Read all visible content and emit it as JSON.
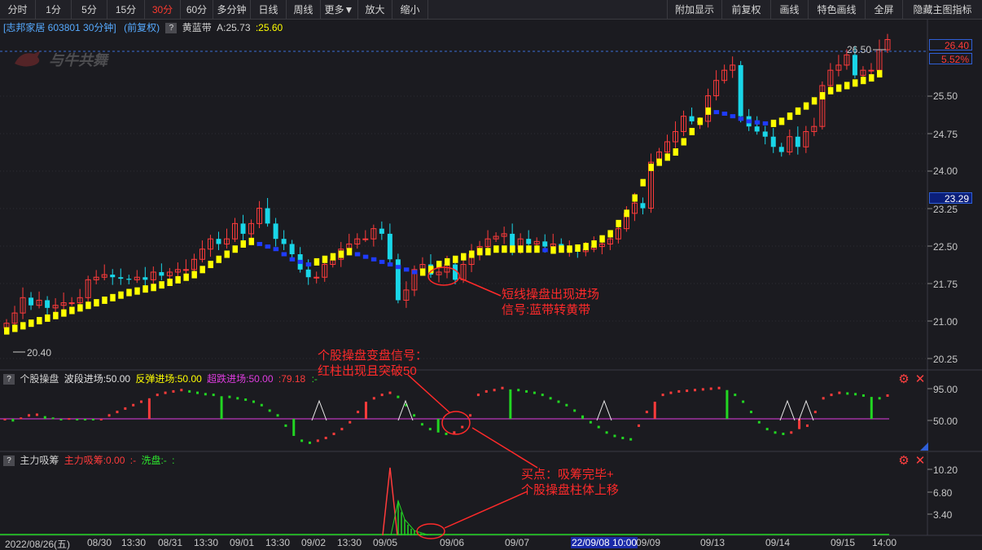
{
  "toolbar": {
    "periods": [
      "分时",
      "1分",
      "5分",
      "15分",
      "30分",
      "60分",
      "多分钟",
      "日线",
      "周线",
      "更多▼",
      "放大",
      "缩小"
    ],
    "active_period": "30分",
    "right_buttons": [
      "附加显示",
      "前复权",
      "画线",
      "特色画线",
      "全屏",
      "隐藏主图指标"
    ]
  },
  "main": {
    "stock_label": "[志邦家居 603801 30分钟]",
    "adjust_label": "(前复权)",
    "qmark": "?",
    "indicator_name": "黄蓝带",
    "indicator_a": "A:25.73",
    "indicator_b": ":25.60",
    "watermark": "与牛共舞",
    "price_tag": "26.40",
    "pct_tag": "5.52%",
    "cursor_price": "23.29",
    "high_mark": "26.50",
    "low_mark": "20.40",
    "y_ticks": [
      "25.50",
      "24.75",
      "24.00",
      "23.25",
      "22.50",
      "21.75",
      "21.00",
      "20.25"
    ]
  },
  "panel1": {
    "qmark": "?",
    "name": "个股操盘",
    "wave": "波段进场:50.00",
    "rebound": "反弹进场:50.00",
    "oversold": "超跌进场:50.00",
    "value": ":79.18",
    "dash": ":-",
    "y_ticks": [
      "95.00",
      "50.00"
    ]
  },
  "panel2": {
    "qmark": "?",
    "name": "主力吸筹",
    "absorb": "主力吸筹:0.00",
    "dash1": ":-",
    "wash": "洗盘:-",
    "dash2": ":",
    "y_ticks": [
      "10.20",
      "6.80",
      "3.40"
    ]
  },
  "x_axis": [
    "2022/08/26(五)",
    "08/30",
    "13:30",
    "08/31",
    "13:30",
    "09/01",
    "13:30",
    "09/02",
    "13:30",
    "09/05",
    "09/06",
    "09/07",
    "22/09/08 10:00",
    "09/09",
    "09/13",
    "09/14",
    "09/15",
    "14:00"
  ],
  "annotations": {
    "a1": [
      "短线操盘出现进场",
      "信号:蓝带转黄带"
    ],
    "a2": [
      "个股操盘变盘信号：",
      "红柱出现且突破50"
    ],
    "a3": [
      "买点：吸筹完毕+",
      "个股操盘柱体上移"
    ]
  },
  "colors": {
    "up": "#ff3b3b",
    "down": "#19d6e8",
    "band_yellow": "#ffff00",
    "band_blue": "#1f3bff",
    "signal_line": "#e03ce0",
    "accent": "#ff2a2a"
  },
  "chart_data": [
    {
      "type": "candlestick",
      "title": "志邦家居 603801 30分钟 (前复权)",
      "ylim": [
        20.0,
        26.6
      ],
      "y_ticks": [
        25.5,
        24.75,
        24.0,
        23.25,
        22.5,
        21.75,
        21.0,
        20.25
      ],
      "high": 26.5,
      "low": 20.4,
      "last": 26.4,
      "change_pct": 5.52,
      "close_series": [
        20.85,
        21.05,
        21.35,
        21.2,
        21.3,
        21.15,
        21.2,
        21.25,
        21.25,
        21.35,
        21.7,
        21.75,
        21.8,
        21.75,
        21.72,
        21.7,
        21.75,
        21.7,
        21.85,
        21.78,
        21.85,
        21.9,
        21.9,
        22.1,
        22.3,
        22.5,
        22.4,
        22.5,
        22.8,
        22.6,
        22.8,
        23.1,
        22.8,
        22.5,
        22.4,
        22.2,
        21.9,
        21.75,
        21.75,
        22.0,
        22.1,
        22.3,
        22.4,
        22.5,
        22.5,
        22.7,
        22.6,
        22.1,
        21.3,
        21.5,
        21.9,
        22.0,
        21.8,
        21.85,
        22.0,
        21.7,
        22.0,
        22.2,
        22.35,
        22.5,
        22.55,
        22.6,
        22.3,
        22.5,
        22.4,
        22.45,
        22.35,
        22.4,
        22.3,
        22.3,
        22.25,
        22.3,
        22.35,
        22.4,
        22.5,
        22.7,
        23.0,
        23.2,
        23.1,
        24.0,
        24.2,
        24.4,
        24.6,
        24.9,
        24.8,
        24.8,
        25.3,
        25.6,
        25.8,
        25.9,
        24.9,
        24.7,
        24.6,
        24.5,
        24.3,
        24.2,
        24.5,
        24.3,
        24.6,
        24.7,
        25.5,
        25.8,
        25.9,
        26.1,
        25.7,
        25.8,
        25.8,
        26.2,
        26.4
      ],
      "band_series": [
        20.7,
        20.75,
        20.8,
        20.85,
        20.9,
        20.95,
        21.0,
        21.05,
        21.1,
        21.15,
        21.2,
        21.25,
        21.3,
        21.35,
        21.4,
        21.45,
        21.48,
        21.52,
        21.55,
        21.6,
        21.65,
        21.7,
        21.75,
        21.8,
        21.9,
        22.0,
        22.1,
        22.2,
        22.3,
        22.4,
        22.45,
        22.4,
        22.35,
        22.3,
        22.2,
        22.1,
        22.05,
        22.0,
        22.05,
        22.1,
        22.15,
        22.2,
        22.25,
        22.2,
        22.15,
        22.1,
        22.05,
        22.0,
        21.95,
        21.9,
        21.85,
        21.85,
        21.9,
        22.0,
        22.05,
        22.1,
        22.15,
        22.2,
        22.25,
        22.25,
        22.3,
        22.3,
        22.3,
        22.3,
        22.3,
        22.3,
        22.28,
        22.28,
        22.3,
        22.3,
        22.32,
        22.35,
        22.4,
        22.5,
        22.6,
        22.8,
        23.0,
        23.3,
        23.6,
        23.9,
        24.0,
        24.1,
        24.2,
        24.4,
        24.6,
        24.8,
        25.0,
        24.98,
        24.95,
        24.9,
        24.85,
        24.8,
        24.78,
        24.76,
        24.76,
        24.8,
        24.9,
        25.0,
        25.1,
        25.2,
        25.3,
        25.4,
        25.45,
        25.5,
        25.55,
        25.6,
        25.65,
        25.73
      ]
    },
    {
      "type": "bar",
      "title": "个股操盘",
      "ylim": [
        0,
        100
      ],
      "reference": 50,
      "values": [
        48,
        46,
        52,
        55,
        56,
        54,
        52,
        50,
        51,
        50,
        49,
        48,
        50,
        55,
        60,
        65,
        70,
        75,
        80,
        85,
        88,
        90,
        92,
        90,
        88,
        86,
        85,
        83,
        82,
        80,
        78,
        75,
        70,
        62,
        55,
        40,
        25,
        18,
        15,
        18,
        22,
        28,
        35,
        45,
        60,
        75,
        80,
        85,
        88,
        82,
        70,
        55,
        42,
        35,
        30,
        28,
        30,
        38,
        55,
        85,
        90,
        92,
        95,
        93,
        92,
        90,
        88,
        85,
        80,
        75,
        70,
        62,
        55,
        45,
        38,
        30,
        25,
        22,
        20,
        40,
        60,
        75,
        85,
        88,
        90,
        91,
        92,
        93,
        94,
        95,
        92,
        85,
        75,
        60,
        45,
        35,
        30,
        28,
        30,
        35,
        40,
        60,
        80,
        85,
        88,
        87,
        86,
        84,
        82,
        80,
        84
      ]
    },
    {
      "type": "bar",
      "title": "主力吸筹",
      "ylim": [
        0,
        11
      ],
      "y_ticks": [
        10.2,
        6.8,
        3.4
      ],
      "values": [
        0,
        0,
        0,
        0,
        0,
        10.2,
        0,
        5.2,
        3.5,
        2.2,
        1.2,
        0.7,
        0.4,
        0.2,
        0.1,
        0,
        0
      ]
    }
  ]
}
